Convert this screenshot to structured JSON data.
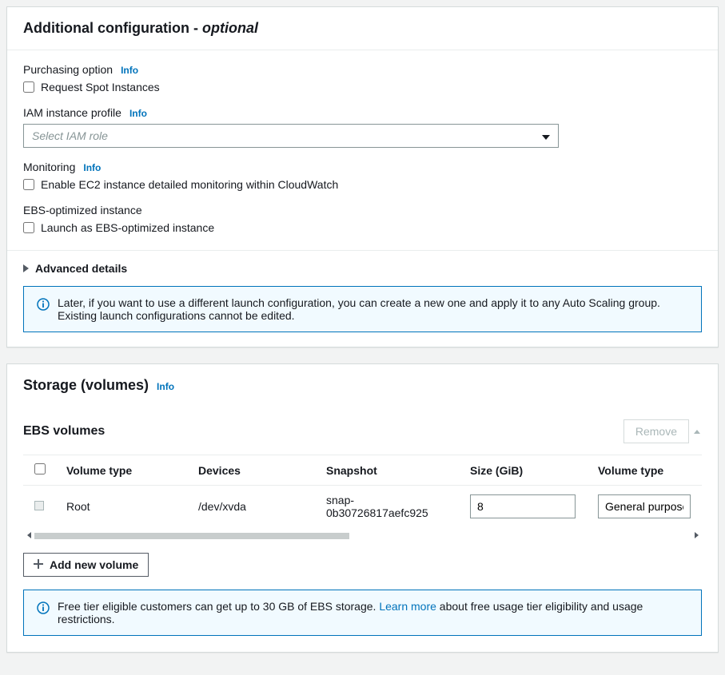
{
  "additional": {
    "title_prefix": "Additional configuration - ",
    "title_optional": "optional",
    "purchasing": {
      "label": "Purchasing option",
      "info": "Info",
      "checkbox_label": "Request Spot Instances"
    },
    "iam": {
      "label": "IAM instance profile",
      "info": "Info",
      "placeholder": "Select IAM role"
    },
    "monitoring": {
      "label": "Monitoring",
      "info": "Info",
      "checkbox_label": "Enable EC2 instance detailed monitoring within CloudWatch"
    },
    "ebs_opt": {
      "label": "EBS-optimized instance",
      "checkbox_label": "Launch as EBS-optimized instance"
    },
    "advanced": "Advanced details",
    "alert": "Later, if you want to use a different launch configuration, you can create a new one and apply it to any Auto Scaling group. Existing launch configurations cannot be edited."
  },
  "storage": {
    "title": "Storage (volumes)",
    "info": "Info",
    "ebs_title": "EBS volumes",
    "remove": "Remove",
    "columns": {
      "voltype_role": "Volume type",
      "devices": "Devices",
      "snapshot": "Snapshot",
      "size": "Size (GiB)",
      "voltype": "Volume type"
    },
    "row": {
      "role": "Root",
      "device": "/dev/xvda",
      "snapshot": "snap-0b30726817aefc925",
      "size": "8",
      "type": "General purpose (SSD)"
    },
    "add_vol": "Add new volume",
    "alert_pre": "Free tier eligible customers can get up to 30 GB of EBS storage. ",
    "alert_link": "Learn more",
    "alert_post": " about free usage tier eligibility and usage restrictions."
  }
}
